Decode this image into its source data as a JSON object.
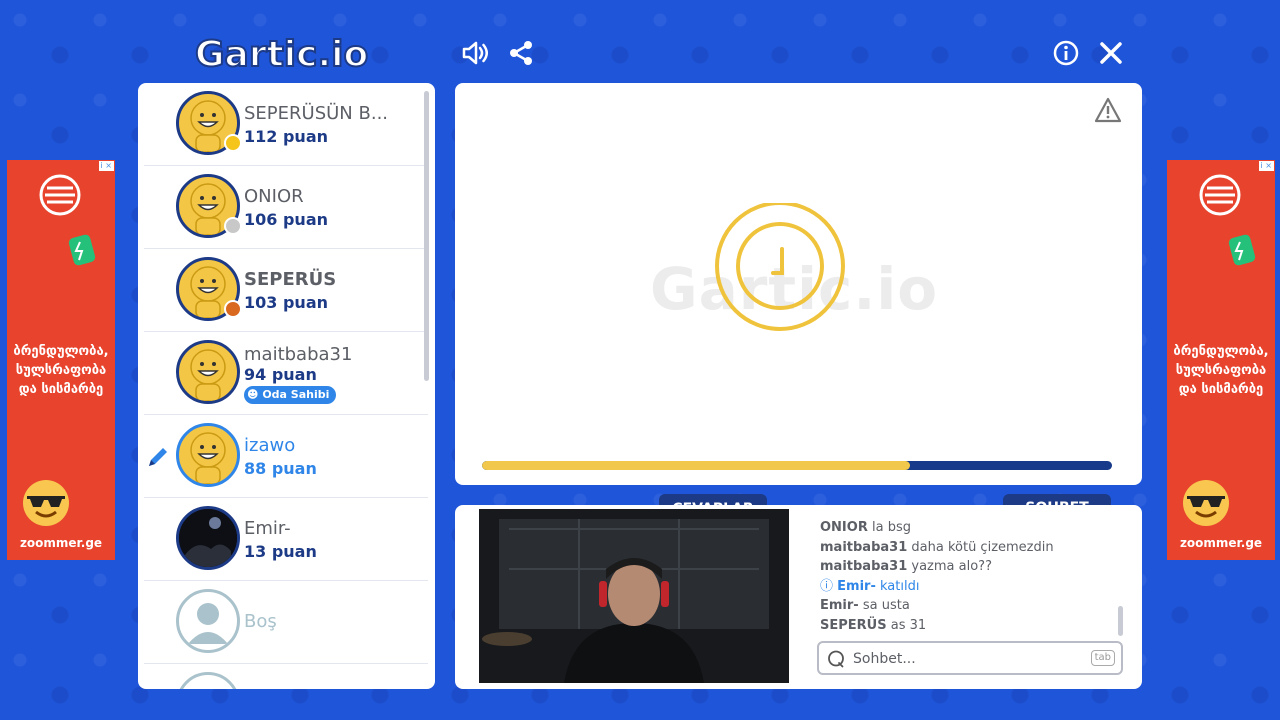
{
  "header": {
    "logo_text": "Gartic.io",
    "icons": [
      "speaker-icon",
      "share-icon",
      "info-icon",
      "close-icon"
    ]
  },
  "ads": {
    "badge": "i ×",
    "text": "ბრენდულობა, სულსრაფობა და სისმარბე",
    "site": "zoommer.ge",
    "color": "#e8432d"
  },
  "players": [
    {
      "name": "SEPERÜSÜN B...",
      "score": "112 puan",
      "medal": "gold"
    },
    {
      "name": "ONIOR",
      "score": "106 puan",
      "medal": "silver"
    },
    {
      "name": "SEPERÜS",
      "score": "103 puan",
      "medal": "bronze"
    },
    {
      "name": "maitbaba31",
      "score": "94 puan",
      "badge": "Oda Sahibi"
    },
    {
      "name": "izawo",
      "score": "88 puan",
      "drawing": true
    },
    {
      "name": "Emir-",
      "score": "13 puan"
    },
    {
      "name": "Boş",
      "score": ""
    }
  ],
  "canvas": {
    "watermark": "Gartic.io",
    "progress_fraction": 0.68,
    "report_icon": "warning-icon"
  },
  "bottom": {
    "tabs": {
      "answers": "CEVAPLAR",
      "chat": "SOHBET"
    },
    "chat_messages": [
      {
        "user": "ONIOR",
        "text": "la bsg"
      },
      {
        "user": "maitbaba31",
        "text": "daha kötü çizemezdin"
      },
      {
        "user": "maitbaba31",
        "text": "yazma alo??"
      },
      {
        "user": "Emir-",
        "text": "katıldı",
        "system": true
      },
      {
        "user": "Emir-",
        "text": "sa usta"
      },
      {
        "user": "SEPERÜS",
        "text": "as 31"
      }
    ],
    "chat_placeholder": "Sohbet...",
    "tab_key": "tab"
  },
  "colors": {
    "background": "#1f55d9",
    "navy": "#1c3a86",
    "accent": "#2f86e8",
    "yellow": "#f1c84b"
  }
}
